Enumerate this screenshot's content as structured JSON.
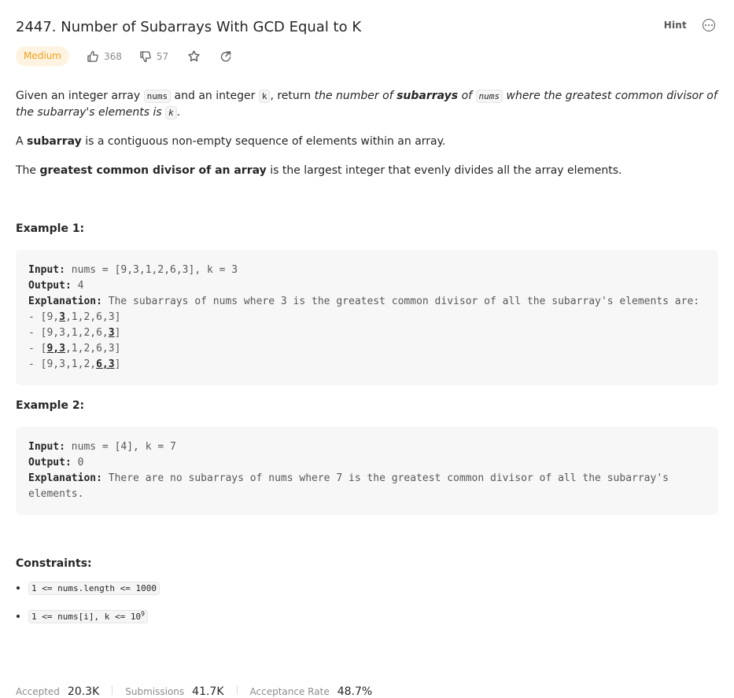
{
  "problem": {
    "title": "2447. Number of Subarrays With GCD Equal to K",
    "hint_label": "Hint",
    "difficulty": "Medium",
    "likes": "368",
    "dislikes": "57"
  },
  "description": {
    "p1_a": "Given an integer array ",
    "p1_code1": "nums",
    "p1_b": " and an integer ",
    "p1_code2": "k",
    "p1_c": ", return ",
    "p1_d": "the number of ",
    "p1_e": "subarrays",
    "p1_f": " of ",
    "p1_code3": "nums",
    "p1_g": " where the greatest common divisor of the subarray's elements is ",
    "p1_code4": "k",
    "p1_h": ".",
    "p2_a": "A ",
    "p2_b": "subarray",
    "p2_c": " is a contiguous non-empty sequence of elements within an array.",
    "p3_a": "The ",
    "p3_b": "greatest common divisor of an array",
    "p3_c": " is the largest integer that evenly divides all the array elements."
  },
  "examples": [
    {
      "title": "Example 1:",
      "input_label": "Input:",
      "input": " nums = [9,3,1,2,6,3], k = 3",
      "output_label": "Output:",
      "output": " 4",
      "explanation_label": "Explanation:",
      "explanation": " The subarrays of nums where 3 is the greatest common divisor of all the subarray's elements are:",
      "lines": [
        {
          "pre": "- [9,",
          "hl": "3",
          "post": ",1,2,6,3]"
        },
        {
          "pre": "- [9,3,1,2,6,",
          "hl": "3",
          "post": "]"
        },
        {
          "pre": "- [",
          "hl": "9,3",
          "post": ",1,2,6,3]"
        },
        {
          "pre": "- [9,3,1,2,",
          "hl": "6,3",
          "post": "]"
        }
      ]
    },
    {
      "title": "Example 2:",
      "input_label": "Input:",
      "input": " nums = [4], k = 7",
      "output_label": "Output:",
      "output": " 0",
      "explanation_label": "Explanation:",
      "explanation": " There are no subarrays of nums where 7 is the greatest common divisor of all the subarray's elements."
    }
  ],
  "constraints": {
    "title": "Constraints:",
    "c1": "1 <= nums.length <= 1000",
    "c2_base": "1 <= nums[i], k <= 10",
    "c2_sup": "9"
  },
  "stats": {
    "accepted_label": "Accepted",
    "accepted_value": "20.3K",
    "submissions_label": "Submissions",
    "submissions_value": "41.7K",
    "rate_label": "Acceptance Rate",
    "rate_value": "48.7%"
  },
  "colors": {
    "medium_badge_bg": "#fef3e0",
    "medium_badge_text": "#f0a020",
    "code_bg": "#f7f7f7"
  }
}
